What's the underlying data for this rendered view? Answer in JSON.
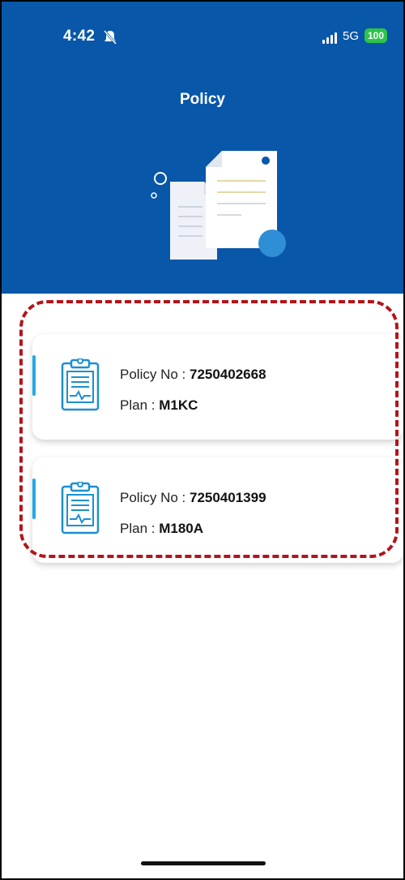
{
  "status_bar": {
    "time": "4:42",
    "network": "5G",
    "battery": "100"
  },
  "header": {
    "title": "Policy"
  },
  "policies": [
    {
      "policy_label": "Policy No : ",
      "policy_no": "7250402668",
      "plan_label": "Plan : ",
      "plan": "M1KC"
    },
    {
      "policy_label": "Policy No : ",
      "policy_no": "7250401399",
      "plan_label": "Plan : ",
      "plan": "M180A"
    }
  ],
  "colors": {
    "header_bg": "#0857a8",
    "accent": "#27a8e6",
    "highlight": "#b3141b"
  }
}
